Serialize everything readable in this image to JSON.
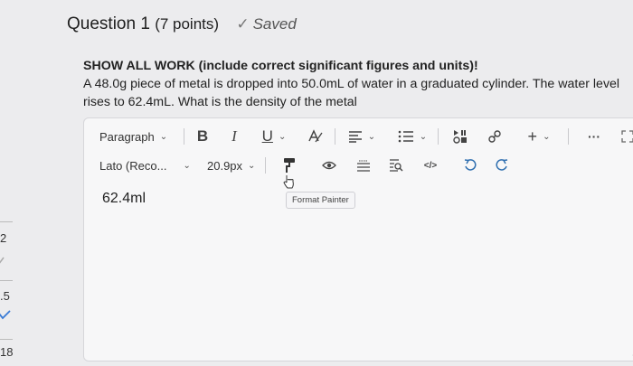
{
  "question_nav": {
    "items": [
      {
        "label": "2"
      },
      {
        "label": ".5"
      },
      {
        "label": "18"
      }
    ]
  },
  "question": {
    "title": "Question 1",
    "points": "(7 points)",
    "status": "Saved"
  },
  "prompt": {
    "bold": "SHOW ALL WORK (include correct significant figures and units)!",
    "text": "A 48.0g piece of metal is dropped into 50.0mL of water in a graduated cylinder.  The water level rises to 62.4mL. What is the density of the metal"
  },
  "toolbar": {
    "block_format": "Paragraph",
    "font_family": "Lato (Reco...",
    "font_size": "20.9px",
    "bold": "B",
    "italic": "I",
    "underline": "U",
    "format_painter_tooltip": "Format Painter"
  },
  "editor": {
    "content": "62.4ml"
  },
  "colors": {
    "accent_blue": "#2f6fb0",
    "saved_check": "#777777"
  }
}
